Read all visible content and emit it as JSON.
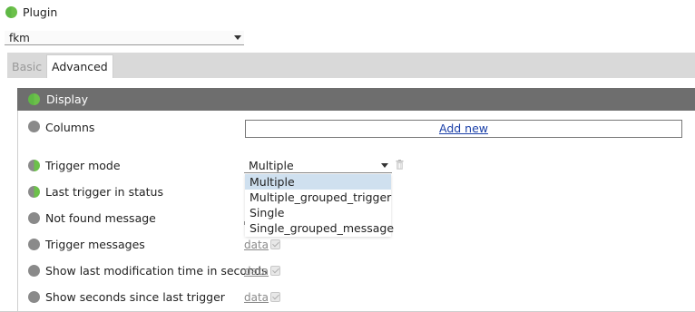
{
  "plugin": {
    "title": "Plugin",
    "selected": "fkm"
  },
  "tabs": [
    {
      "label": "Basic"
    },
    {
      "label": "Advanced"
    }
  ],
  "section": {
    "title": "Display"
  },
  "rows": {
    "columns": {
      "label": "Columns",
      "action": "Add new"
    },
    "trigger_mode": {
      "label": "Trigger mode",
      "value": "Multiple",
      "options": [
        "Multiple",
        "Multiple_grouped_trigger",
        "Single",
        "Single_grouped_message"
      ]
    },
    "last_trigger_in_status": {
      "label": "Last trigger in status"
    },
    "not_found_message": {
      "label": "Not found message"
    },
    "trigger_messages": {
      "label": "Trigger messages",
      "link": "data"
    },
    "show_last_mod_time": {
      "label": "Show last modification time in seconds",
      "link": "data"
    },
    "show_seconds_since": {
      "label": "Show seconds since last trigger",
      "link": "data"
    }
  },
  "colors": {
    "header_bg": "#6e6e6e",
    "status_grey": "#8a8a8a",
    "status_green": "#6cc04a",
    "link_blue": "#1a3fa8",
    "option_highlight": "#cfe0ef"
  }
}
